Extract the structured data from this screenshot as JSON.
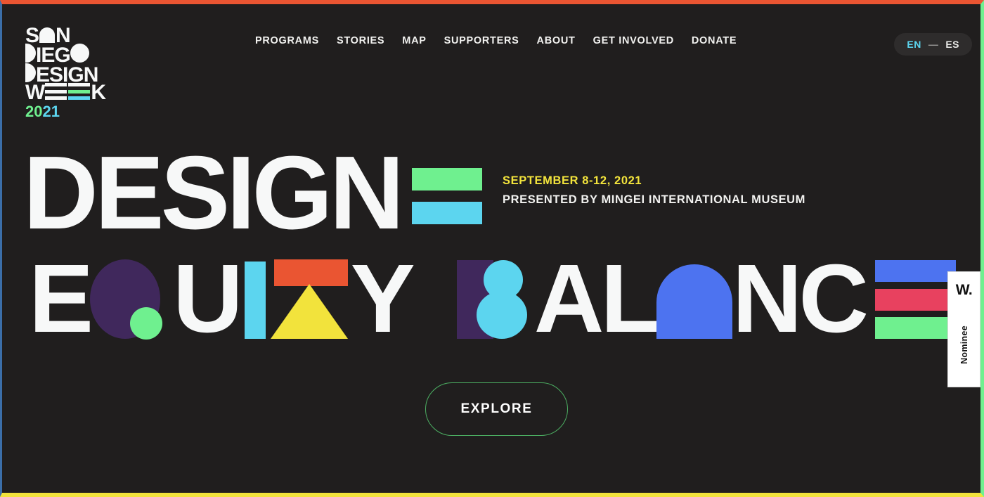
{
  "site": {
    "background": "#201e1e",
    "borders": {
      "top": "#ea5532",
      "left": "#3b6ea8",
      "right": "#6ff08f",
      "bottom": "#f2e33c"
    }
  },
  "logo": {
    "line1": "SAN",
    "line2": "DIEGO",
    "line3": "DESIGN",
    "line4": "WEEK",
    "year_part1": "20",
    "year_part2": "21",
    "year": "2021",
    "alt": "San Diego Design Week 2021"
  },
  "nav": {
    "items": [
      {
        "label": "PROGRAMS"
      },
      {
        "label": "STORIES"
      },
      {
        "label": "MAP"
      },
      {
        "label": "SUPPORTERS"
      },
      {
        "label": "ABOUT"
      },
      {
        "label": "GET INVOLVED"
      },
      {
        "label": "DONATE"
      }
    ]
  },
  "language": {
    "active": "EN",
    "separator": "—",
    "inactive": "ES"
  },
  "hero": {
    "word1": "DESIGN",
    "word2": "EQUITY",
    "word3": "BALANCE",
    "headline": "DESIGN = EQUITY BALANCE",
    "date": "SEPTEMBER 8-12, 2021",
    "presented_by": "PRESENTED BY MINGEI INTERNATIONAL MUSEUM",
    "equals_bar_colors": [
      "#6ff08f",
      "#5cd5ef"
    ],
    "balance_e_colors": [
      "#4d73f0",
      "#e8415f",
      "#6ff08f"
    ],
    "word2_letters": [
      "E",
      "Q",
      "U",
      "I",
      "T",
      "Y"
    ],
    "word3_letters": [
      "B",
      "A",
      "L",
      "A",
      "N",
      "C",
      "E"
    ],
    "date_color": "#f2e33c"
  },
  "cta": {
    "label": "EXPLORE",
    "border_color": "#4cae62"
  },
  "badge": {
    "mark": "W.",
    "label": "Nominee"
  },
  "colors": {
    "white": "#f7f8f8",
    "green": "#6ff08f",
    "cyan": "#5cd5ef",
    "purple": "#40285c",
    "orange": "#ea5532",
    "yellow": "#f2e33c",
    "blue": "#4d73f0",
    "pink": "#e8415f"
  }
}
